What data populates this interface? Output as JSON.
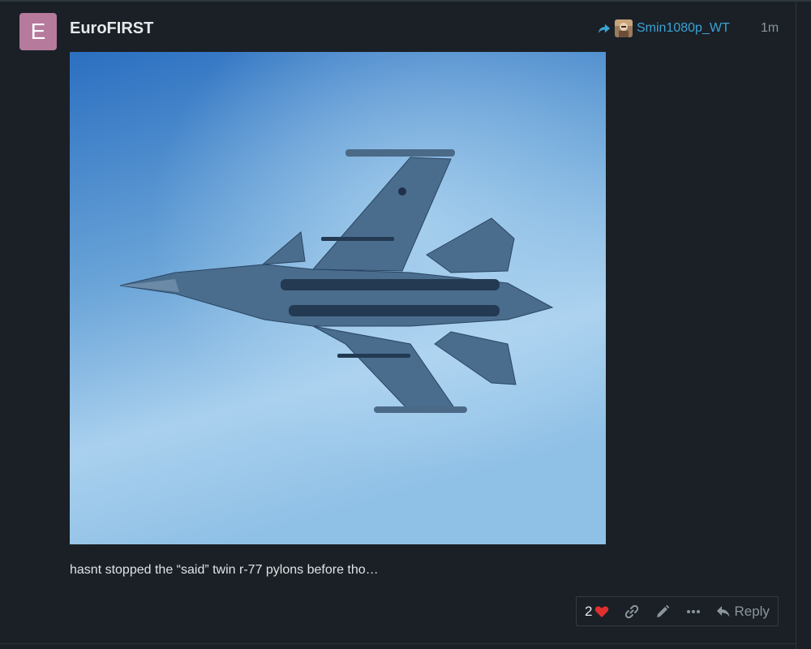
{
  "post": {
    "avatar_letter": "E",
    "avatar_color": "#b57a9c",
    "username": "EuroFIRST",
    "reply_to": {
      "icon": "share-arrow-icon",
      "username": "Smin1080p_WT"
    },
    "age": "1m",
    "image": {
      "subject": "fighter-jet-photo"
    },
    "text": "hasnt stopped the “said” twin r-77 pylons before tho…"
  },
  "actions": {
    "like_count": "2",
    "like_icon": "heart-icon",
    "link_icon": "link-icon",
    "edit_icon": "pencil-icon",
    "more_icon": "ellipsis-icon",
    "reply_label": "Reply",
    "reply_icon": "reply-arrow-icon"
  },
  "colors": {
    "background": "#1a2026",
    "link": "#3aa3d6",
    "heart": "#e02f2f",
    "muted": "#8b959c"
  }
}
